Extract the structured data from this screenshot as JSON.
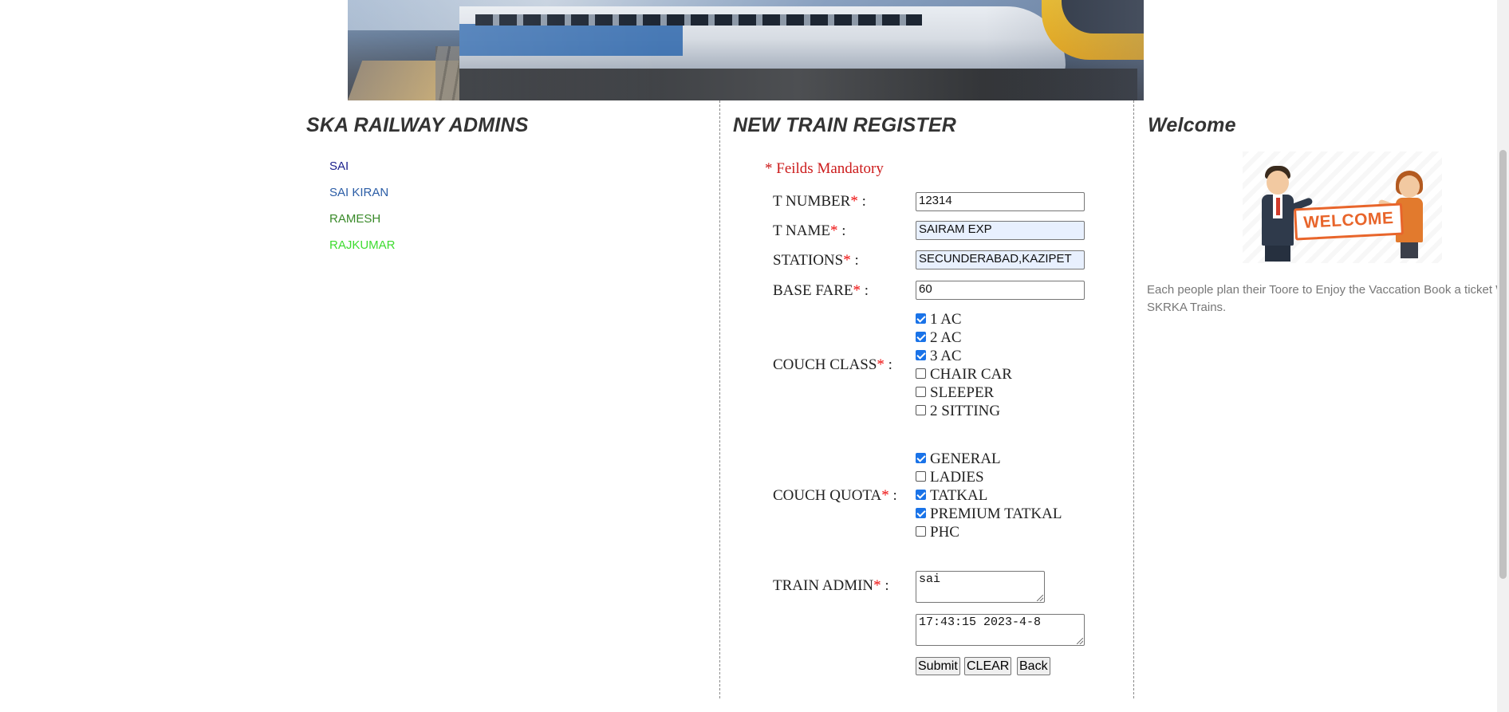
{
  "banner": {
    "icon": "train-photo-banner"
  },
  "admins": {
    "heading": "SKA RAILWAY ADMINS",
    "items": [
      {
        "label": "SAI",
        "color": "#1a1f8c"
      },
      {
        "label": "SAI KIRAN",
        "color": "#2b5da6"
      },
      {
        "label": "RAMESH",
        "color": "#3a8a2a"
      },
      {
        "label": "RAJKUMAR",
        "color": "#3ddc2f"
      }
    ]
  },
  "register": {
    "heading": "NEW TRAIN REGISTER",
    "mandatory_note": "* Feilds Mandatory",
    "star": "*",
    "fields": {
      "t_number": {
        "label": "T NUMBER",
        "suffix": " :",
        "value": "12314"
      },
      "t_name": {
        "label": "T NAME",
        "suffix": " :",
        "value": "SAIRAM EXP"
      },
      "stations": {
        "label": "STATIONS",
        "suffix": " :",
        "value": "SECUNDERABAD,KAZIPET"
      },
      "base_fare": {
        "label": "BASE FARE",
        "suffix": " :",
        "value": "60"
      },
      "couch_class": {
        "label": "COUCH CLASS",
        "suffix": " :",
        "options": [
          {
            "label": "1 AC",
            "checked": true
          },
          {
            "label": "2 AC",
            "checked": true
          },
          {
            "label": "3 AC",
            "checked": true
          },
          {
            "label": "CHAIR CAR",
            "checked": false
          },
          {
            "label": "SLEEPER",
            "checked": false
          },
          {
            "label": "2 SITTING",
            "checked": false
          }
        ]
      },
      "couch_quota": {
        "label": "COUCH QUOTA",
        "suffix": " :",
        "options": [
          {
            "label": "GENERAL",
            "checked": true
          },
          {
            "label": "LADIES",
            "checked": false
          },
          {
            "label": "TATKAL",
            "checked": true
          },
          {
            "label": "PREMIUM TATKAL",
            "checked": true
          },
          {
            "label": "PHC",
            "checked": false
          }
        ]
      },
      "train_admin": {
        "label": "TRAIN ADMIN",
        "suffix": " :",
        "value": "sai"
      },
      "timestamp": {
        "value": "17:43:15 2023-4-8"
      }
    },
    "buttons": {
      "submit": "Submit",
      "clear": "CLEAR",
      "back": "Back"
    }
  },
  "welcome": {
    "heading": "Welcome",
    "image_text": "WELCOME",
    "text_line1": "Each people plan their Toore to Enjoy the Vaccation Book a ticket W",
    "text_line2": "SKRKA Trains."
  },
  "colors": {
    "accent": "#1a73e8",
    "mandatory": "#cc1b1b",
    "star": "#ee1111"
  }
}
